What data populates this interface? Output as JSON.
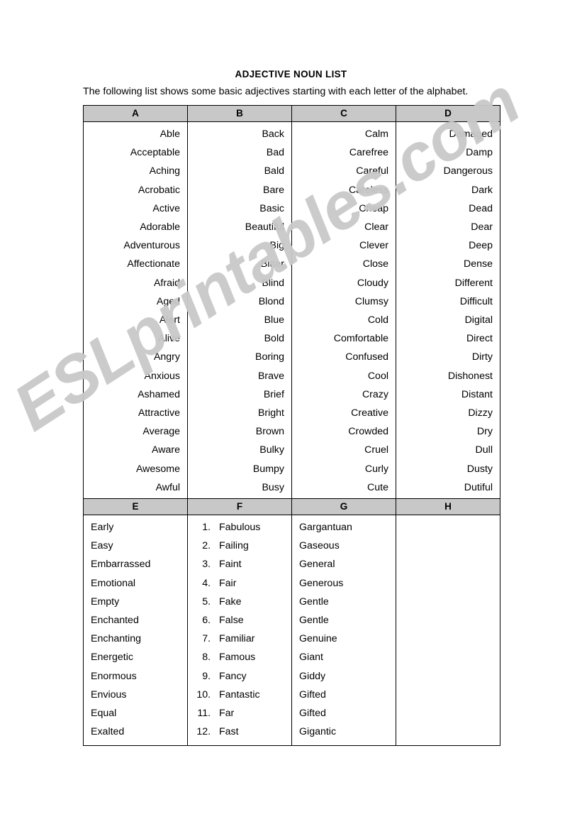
{
  "document": {
    "title": "ADJECTIVE NOUN LIST",
    "intro": "The following list shows some basic adjectives starting with each letter of the alphabet.",
    "watermark": "ESLprintables.com",
    "watermark_color": "#c9c9c9"
  },
  "tables": [
    {
      "id": "table-top",
      "headers": [
        "A",
        "B",
        "C",
        "D"
      ],
      "alignment": "right",
      "columns": [
        {
          "letter": "A",
          "type": "plain",
          "words": [
            "Able",
            "Acceptable",
            "Aching",
            "Acrobatic",
            "Active",
            "Adorable",
            "Adventurous",
            "Affectionate",
            "Afraid",
            "Aged",
            "Alert",
            "Alive",
            "Angry",
            "Anxious",
            "Ashamed",
            "Attractive",
            "Average",
            "Aware",
            "Awesome",
            "Awful"
          ]
        },
        {
          "letter": "B",
          "type": "plain",
          "words": [
            "Back",
            "Bad",
            "Bald",
            "Bare",
            "Basic",
            "Beautiful",
            "Big",
            "Bitter",
            "Blind",
            "Blond",
            "Blue",
            "Bold",
            "Boring",
            "Brave",
            "Brief",
            "Bright",
            "Brown",
            "Bulky",
            "Bumpy",
            "Busy"
          ]
        },
        {
          "letter": "C",
          "type": "plain",
          "words": [
            "Calm",
            "Carefree",
            "Careful",
            "Careless",
            "Cheap",
            "Clear",
            "Clever",
            "Close",
            "Cloudy",
            "Clumsy",
            "Cold",
            "Comfortable",
            "Confused",
            "Cool",
            "Crazy",
            "Creative",
            "Crowded",
            "Cruel",
            "Curly",
            "Cute"
          ]
        },
        {
          "letter": "D",
          "type": "plain",
          "words": [
            "Damaged",
            "Damp",
            "Dangerous",
            "Dark",
            "Dead",
            "Dear",
            "Deep",
            "Dense",
            "Different",
            "Difficult",
            "Digital",
            "Direct",
            "Dirty",
            "Dishonest",
            "Distant",
            "Dizzy",
            "Dry",
            "Dull",
            "Dusty",
            "Dutiful"
          ]
        }
      ]
    },
    {
      "id": "table-bottom",
      "headers": [
        "E",
        "F",
        "G",
        "H"
      ],
      "alignment": "left",
      "columns": [
        {
          "letter": "E",
          "type": "plain",
          "words": [
            "Early",
            "Easy",
            "Embarrassed",
            "Emotional",
            "Empty",
            "Enchanted",
            "Enchanting",
            "Energetic",
            "Enormous",
            "Envious",
            "Equal",
            "Exalted"
          ]
        },
        {
          "letter": "F",
          "type": "numbered",
          "words": [
            "Fabulous",
            "Failing",
            "Faint",
            "Fair",
            "Fake",
            "False",
            "Familiar",
            "Famous",
            "Fancy",
            "Fantastic",
            "Far",
            "Fast"
          ]
        },
        {
          "letter": "G",
          "type": "plain",
          "words": [
            "Gargantuan",
            "Gaseous",
            "General",
            "Generous",
            "Gentle",
            "Gentle",
            "Genuine",
            "Giant",
            "Giddy",
            "Gifted",
            "Gifted",
            "Gigantic"
          ]
        },
        {
          "letter": "H",
          "type": "plain",
          "words": []
        }
      ]
    }
  ]
}
